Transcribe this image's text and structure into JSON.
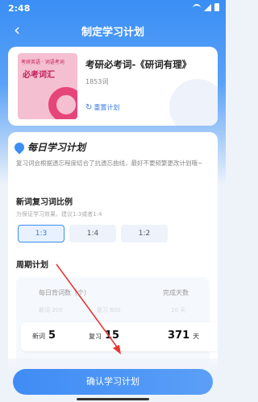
{
  "status_bar": {
    "time": "2:48"
  },
  "nav": {
    "title": "制定学习计划"
  },
  "book": {
    "cover_subtitle": "考研英语 · 词语考词",
    "cover_title": "必考词汇",
    "title": "考研必考词-《研词有理》",
    "word_count": "1853词",
    "reset_label": "重置计划"
  },
  "plan": {
    "title": "每日学习计划",
    "description": "复习词会根据遗忘程度结合了抗遗忘曲线，最好不要频繁更改计划哦~",
    "ratio_section": {
      "title": "新词复习词比例",
      "hint": "为保证学习效果，建议1:3或者1:4",
      "options": [
        "1:3",
        "1:4",
        "1:2"
      ],
      "selected": "1:3"
    },
    "cycle_section": {
      "title": "周期计划",
      "col_daily": "每日背词数（个）",
      "col_days": "完成天数",
      "ghost_new": "新词 200",
      "ghost_review": "复习 600",
      "ghost_days": "10 天",
      "new_label": "新词",
      "new_value": "5",
      "review_label": "复习",
      "review_value": "15",
      "days_value": "371",
      "days_unit": "天"
    }
  },
  "confirm_label": "确认学习计划",
  "colors": {
    "accent": "#3a8ef5",
    "annotation_arrow": "#e53935"
  }
}
